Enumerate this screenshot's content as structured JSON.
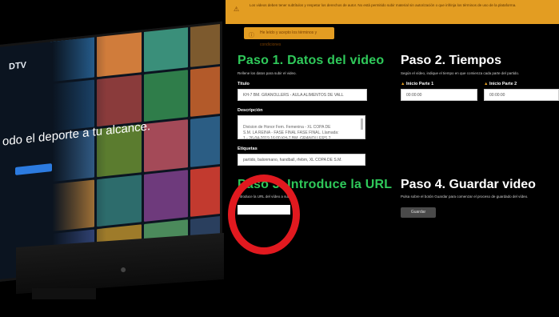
{
  "monitor": {
    "brand": "DTV",
    "tagline": "odo el deporte a tu alcance."
  },
  "warning": {
    "text": "Los videos deben tener subtítulos y respetar los derechos de autor. No está permitido subir material sin autorización o que infrinja los términos de uso de la plataforma."
  },
  "terms": {
    "label": "He leído y acepto los términos y condiciones"
  },
  "step1": {
    "title": "Paso 1. Datos del video",
    "hint": "Rellene los datos para subir el video.",
    "titulo_label": "Titulo",
    "titulo_value": "KH-7 BM. GRANOLLERS - AULA ALIMENTOS DE VALL",
    "descripcion_label": "Descripción",
    "descripcion_value": "Division de Honor Fem. Femenina - XL COPA DE\nS.M. LA REINA - FASE FINAL FASE FINAL. Llamada:\n1 - 26-04-2019 16:00 KH-7 BM. GRANOLLERS 2",
    "etiquetas_label": "Etiquetas",
    "etiquetas_value": "partido, balonmano, handball, rfebm, XL COPA DE S.M."
  },
  "step2": {
    "title": "Paso 2. Tiempos",
    "hint": "Según el vídeo, indique el tiempo en que comienza cada parte del partido.",
    "parte1_label": "Inicio Parte 1",
    "parte1_value": "00:00:00",
    "parte2_label": "Inicio Parte 2",
    "parte2_value": "00:00:00"
  },
  "step3": {
    "title": "Paso 3. Introduce la URL",
    "hint": "Introduce la URL del vídeo a subir.",
    "url_value": ""
  },
  "step4": {
    "title": "Paso 4. Guardar video",
    "hint": "Pulsa sobre el botón Guardar para comenzar el proceso de guardado del vídeo.",
    "button_label": "Guardar"
  },
  "icons": {
    "warning": "warning-icon",
    "info": "info-icon",
    "apple": "apple-logo-icon"
  },
  "colors": {
    "accent_green": "#2fc95a",
    "warning_orange": "#e39d22",
    "annotation_red": "#e1191f"
  }
}
